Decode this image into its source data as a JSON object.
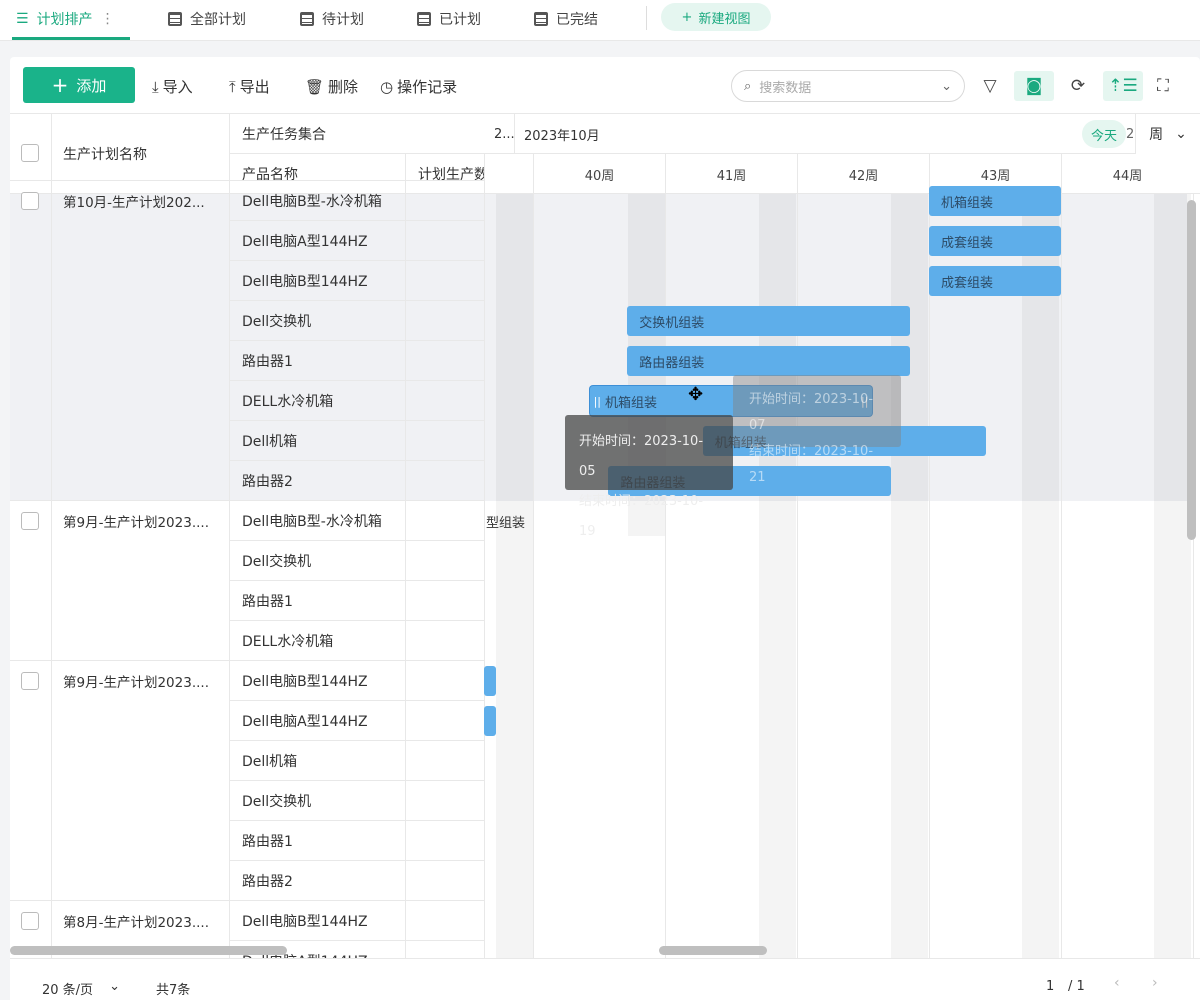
{
  "tabs": [
    {
      "label": "计划排产",
      "active": true
    },
    {
      "label": "全部计划"
    },
    {
      "label": "待计划"
    },
    {
      "label": "已计划"
    },
    {
      "label": "已完结"
    }
  ],
  "new_view": "新建视图",
  "toolbar": {
    "add": "添加",
    "import": "导入",
    "export": "导出",
    "delete": "删除",
    "history": "操作记录",
    "search_placeholder": "搜索数据"
  },
  "columns": {
    "name": "生产计划名称",
    "task_group": "生产任务集合",
    "product": "产品名称",
    "qty": "计划生产数"
  },
  "gantt": {
    "month_prev": "2...",
    "month": "2023年10月",
    "today": "今天",
    "today_trunc": "2",
    "scale": "周",
    "weeks": [
      "40周",
      "41周",
      "42周",
      "43周",
      "44周"
    ]
  },
  "groups": [
    {
      "name": "第10月-生产计划202...",
      "products": [
        "Dell电脑B型-水冷机箱",
        "Dell电脑A型144HZ",
        "Dell电脑B型144HZ",
        "Dell交换机",
        "路由器1",
        "DELL水冷机箱",
        "Dell机箱",
        "路由器2"
      ]
    },
    {
      "name": "第9月-生产计划2023....",
      "products": [
        "Dell电脑B型-水冷机箱",
        "Dell交换机",
        "路由器1",
        "DELL水冷机箱"
      ]
    },
    {
      "name": "第9月-生产计划2023....",
      "products": [
        "Dell电脑B型144HZ",
        "Dell电脑A型144HZ",
        "Dell机箱",
        "Dell交换机",
        "路由器1",
        "路由器2"
      ]
    },
    {
      "name": "第8月-生产计划2023....",
      "products": [
        "Dell电脑B型144HZ",
        "Dell电脑A型144HZ"
      ]
    }
  ],
  "bars": [
    {
      "row": 0,
      "label": "机箱组装",
      "start": "2023-10-23",
      "end": "2023-10-29"
    },
    {
      "row": 1,
      "label": "成套组装",
      "start": "2023-10-23",
      "end": "2023-10-29"
    },
    {
      "row": 2,
      "label": "成套组装",
      "start": "2023-10-23",
      "end": "2023-10-29"
    },
    {
      "row": 3,
      "label": "交换机组装",
      "start": "2023-10-07",
      "end": "2023-10-21"
    },
    {
      "row": 4,
      "label": "路由器组装",
      "start": "2023-10-07",
      "end": "2023-10-21"
    },
    {
      "row": 5,
      "label": "机箱组装",
      "start": "2023-10-05",
      "end": "2023-10-19",
      "dragging": true
    },
    {
      "row": 6,
      "label": "机箱组装",
      "start": "2023-10-11",
      "end": "2023-10-25"
    },
    {
      "row": 7,
      "label": "路由器组装",
      "start": "2023-10-06",
      "end": "2023-10-20"
    },
    {
      "row": 8,
      "label": "型组装",
      "start": "2023-09-20",
      "end": "2023-09-25"
    },
    {
      "row": 12,
      "label": "",
      "start": "2023-09-25",
      "end": "2023-09-26"
    },
    {
      "row": 13,
      "label": "",
      "start": "2023-09-25",
      "end": "2023-09-26"
    }
  ],
  "tooltip": {
    "start_label": "开始时间：",
    "start": "2023-10-05",
    "end_label": "结束时间：",
    "end": "2023-10-19"
  },
  "ghost_tooltip": {
    "start_label": "开始时间：",
    "start": "2023-10-07",
    "end_label": "结束时间：",
    "end": "2023-10-21"
  },
  "footer": {
    "page_size": "20 条/页",
    "total": "共7条",
    "page": "1",
    "pages": "/ 1"
  },
  "colors": {
    "accent": "#1ab38a",
    "bar": "#5eaeea"
  }
}
